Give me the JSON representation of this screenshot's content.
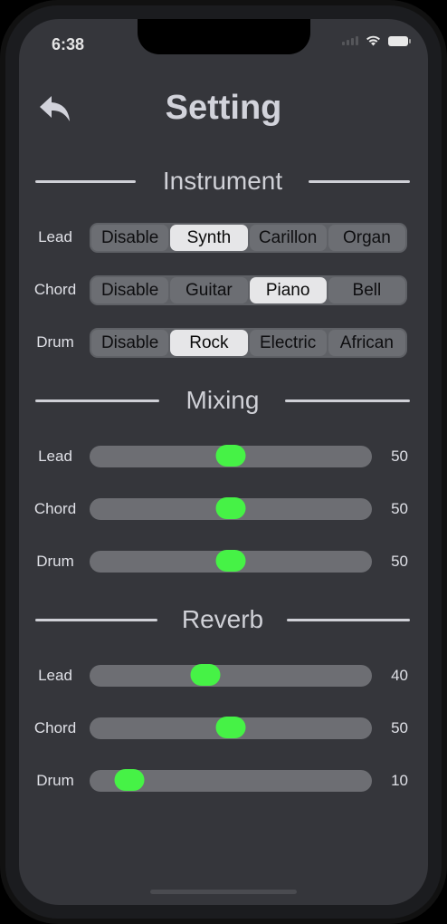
{
  "status": {
    "time": "6:38"
  },
  "header": {
    "title": "Setting"
  },
  "instrument": {
    "heading": "Instrument",
    "rows": [
      {
        "label": "Lead",
        "options": [
          "Disable",
          "Synth",
          "Carillon",
          "Organ"
        ],
        "selected": 1
      },
      {
        "label": "Chord",
        "options": [
          "Disable",
          "Guitar",
          "Piano",
          "Bell"
        ],
        "selected": 2
      },
      {
        "label": "Drum",
        "options": [
          "Disable",
          "Rock",
          "Electric",
          "African"
        ],
        "selected": 1
      }
    ]
  },
  "mixing": {
    "heading": "Mixing",
    "rows": [
      {
        "label": "Lead",
        "value": "50",
        "percent": 50
      },
      {
        "label": "Chord",
        "value": "50",
        "percent": 50
      },
      {
        "label": "Drum",
        "value": "50",
        "percent": 50
      }
    ]
  },
  "reverb": {
    "heading": "Reverb",
    "rows": [
      {
        "label": "Lead",
        "value": "40",
        "percent": 40
      },
      {
        "label": "Chord",
        "value": "50",
        "percent": 50
      },
      {
        "label": "Drum",
        "value": "10",
        "percent": 10
      }
    ]
  },
  "colors": {
    "accent": "#46f246",
    "background": "#35363b",
    "track": "#6d6e73"
  }
}
